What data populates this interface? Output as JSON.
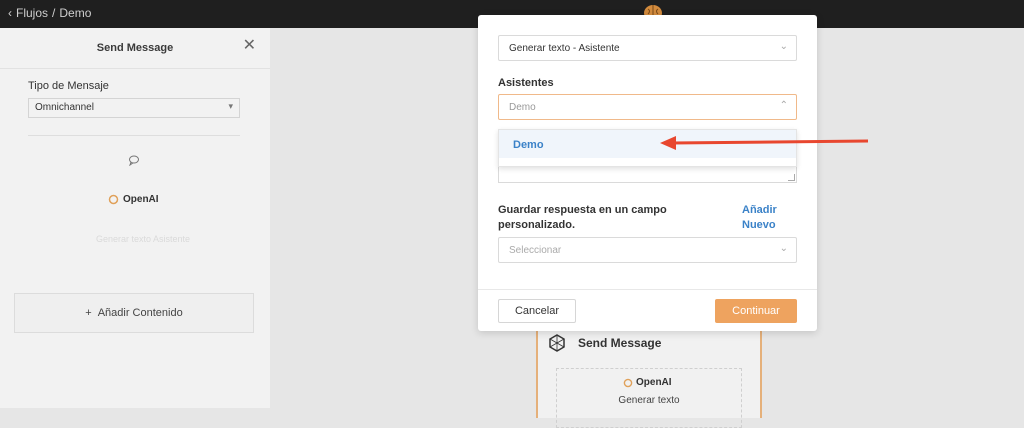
{
  "topbar": {
    "back": "‹",
    "crumb1": "Flujos",
    "sep": "/",
    "crumb2": "Demo"
  },
  "panel": {
    "title": "Send Message",
    "close": "✕",
    "tipo_label": "Tipo de Mensaje",
    "tipo_value": "Omnichannel",
    "openai_label": "OpenAI",
    "faded": "Generar texto Asistente",
    "add_content": "Añadir Contenido",
    "add_plus": "+"
  },
  "card": {
    "title": "Send Message",
    "openai": "OpenAI",
    "generate": "Generar texto"
  },
  "modal": {
    "action_value": "Generar texto - Asistente",
    "assistants_label": "Asistentes",
    "assistants_value": "Demo",
    "dropdown_option": "Demo",
    "save_label": "Guardar respuesta en un campo personalizado.",
    "add_new": "Añadir Nuevo",
    "select_placeholder": "Seleccionar",
    "cancel": "Cancelar",
    "continue": "Continuar"
  },
  "colors": {
    "accent": "#eea35f",
    "link": "#3b82c8",
    "arrow": "#e8472f"
  }
}
